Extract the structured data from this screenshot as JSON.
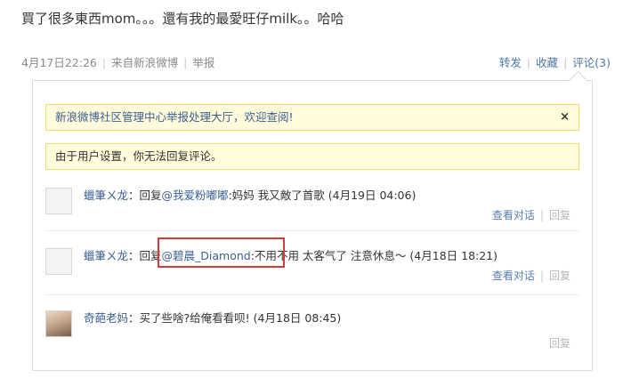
{
  "post": {
    "text": "買了很多東西mom。。。還有我的最愛旺仔milk。。哈哈",
    "time": "4月17日22:26",
    "source": "来自新浪微博",
    "report": "举报"
  },
  "actions": {
    "forward": "转发",
    "favorite": "收藏",
    "comment": "评论(3)"
  },
  "notices": {
    "report_hall": "新浪微博社区管理中心举报处理大厅，欢迎查阅!",
    "close": "×",
    "no_reply": "由于用户设置，你无法回复评论。"
  },
  "comments": [
    {
      "name": "蠟筆ㄨ龙",
      "reply_prefix": "回复",
      "mention": "@我爱粉嘟嘟",
      "text": ":妈妈 我又敵了首歌",
      "time": "(4月19日 04:06)",
      "view_convo": "查看对话",
      "reply": "回复"
    },
    {
      "name": "蠟筆ㄨ龙",
      "reply_prefix": "回复",
      "mention": "@碧晨_Diamond",
      "text": ":不用不用 太客气了 注意休息～",
      "time": "(4月18日 18:21)",
      "view_convo": "查看对话",
      "reply": "回复"
    },
    {
      "name": "奇葩老妈",
      "text": "：买了些啥?给俺看看呗!",
      "time": "(4月18日 08:45)",
      "reply": "回复"
    }
  ]
}
